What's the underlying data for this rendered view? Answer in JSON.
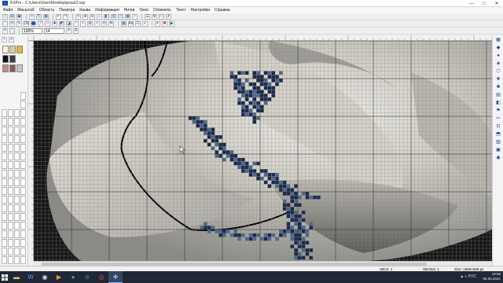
{
  "window": {
    "title": "KXPro - C:\\Users\\User\\Desktop\\роза\\2.xsp",
    "minimize": "—",
    "maximize": "□",
    "close": "✕"
  },
  "menu": [
    "Файл",
    "Масштаб",
    "Область",
    "Палитра",
    "Канва",
    "Информация",
    "Нитки",
    "Окно",
    "Отменить",
    "Текст",
    "Настройки",
    "Справка"
  ],
  "toolbar": {
    "zoom_value": "100%",
    "zoom_value2": "14"
  },
  "status": {
    "left": "",
    "stitch_label": "Stitch: 1",
    "colors_label": "Stitches: 1",
    "size_label": "Size: 1665×665 px"
  },
  "taskbar": {
    "time": "19:58",
    "date": "05.05.2021",
    "lang": "РУС"
  },
  "colors": {
    "accent": "#1b4f9c",
    "taskbar": "#202838",
    "grid_line": "#8a8a8a",
    "grid_major": "#3a3a3a",
    "stitch_dark": "#1c2a4a",
    "stitch_light": "#4d6790"
  }
}
